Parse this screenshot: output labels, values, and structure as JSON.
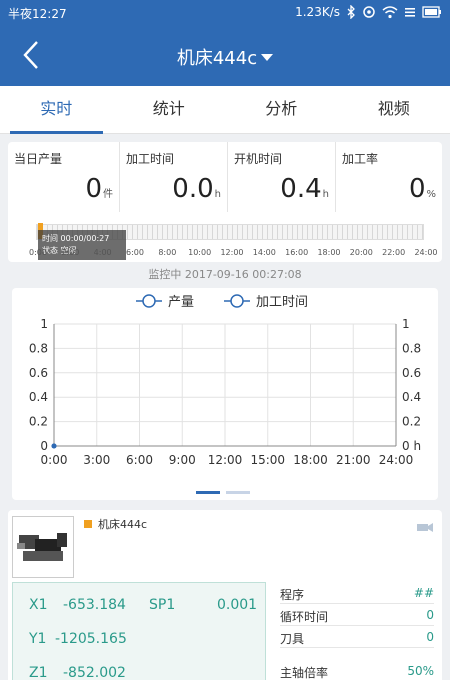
{
  "status_bar": {
    "time": "半夜12:27",
    "network_speed": "1.23K/s",
    "icons": [
      "bluetooth-icon",
      "settings-icon",
      "wifi-icon",
      "battery-icon"
    ]
  },
  "header": {
    "title": "机床444c",
    "back_icon": "chevron-left-icon",
    "dropdown_icon": "caret-down-icon"
  },
  "tabs": [
    {
      "label": "实时",
      "active": true
    },
    {
      "label": "统计",
      "active": false
    },
    {
      "label": "分析",
      "active": false
    },
    {
      "label": "视频",
      "active": false
    }
  ],
  "stats": [
    {
      "label": "当日产量",
      "value": "0",
      "unit": "件"
    },
    {
      "label": "加工时间",
      "value": "0.0",
      "unit": "h"
    },
    {
      "label": "开机时间",
      "value": "0.4",
      "unit": "h"
    },
    {
      "label": "加工率",
      "value": "0",
      "unit": "%"
    }
  ],
  "timeline": {
    "tooltip_line1": "时间 00:00/00:27",
    "tooltip_line2": "状态 空闲",
    "ticks": [
      "0:00",
      "2:00",
      "4:00",
      "6:00",
      "8:00",
      "10:00",
      "12:00",
      "14:00",
      "16:00",
      "18:00",
      "20:00",
      "22:00",
      "24:00"
    ]
  },
  "monitor_text": "监控中  2017-09-16 00:27:08",
  "chart_data": {
    "type": "line",
    "title": "",
    "x": [
      "0:00",
      "3:00",
      "6:00",
      "9:00",
      "12:00",
      "15:00",
      "18:00",
      "21:00",
      "24:00"
    ],
    "series": [
      {
        "name": "产量",
        "values": [
          0
        ]
      },
      {
        "name": "加工时间",
        "values": [
          0
        ]
      }
    ],
    "ylim": [
      0,
      1
    ],
    "y_ticks": [
      "0",
      "0.2",
      "0.4",
      "0.6",
      "0.8",
      "1"
    ],
    "y2_ticks": [
      "0 h",
      "0.2",
      "0.4",
      "0.6",
      "0.8",
      "1"
    ],
    "grid": true,
    "legend": "top-center",
    "colors": {
      "series": "#2e6ab4"
    }
  },
  "pager": {
    "pages": 2,
    "active": 0
  },
  "machine": {
    "name": "机床444c",
    "status_color": "#f0a020",
    "camera_icon": "camera-icon",
    "coords": [
      {
        "axis": "X1",
        "value": "-653.184"
      },
      {
        "axis": "SP1",
        "value": "0.001"
      },
      {
        "axis": "Y1",
        "value": "-1205.165"
      },
      {
        "axis": "Z1",
        "value": "-852.002"
      }
    ],
    "params": [
      {
        "label": "程序",
        "value": "##"
      },
      {
        "label": "循环时间",
        "value": "0"
      },
      {
        "label": "刀具",
        "value": "0"
      },
      {
        "label": "主轴倍率",
        "value": "50%"
      }
    ]
  },
  "colors": {
    "primary": "#2e6ab4",
    "accent": "#f0a020",
    "teal": "#2a9a8a"
  }
}
